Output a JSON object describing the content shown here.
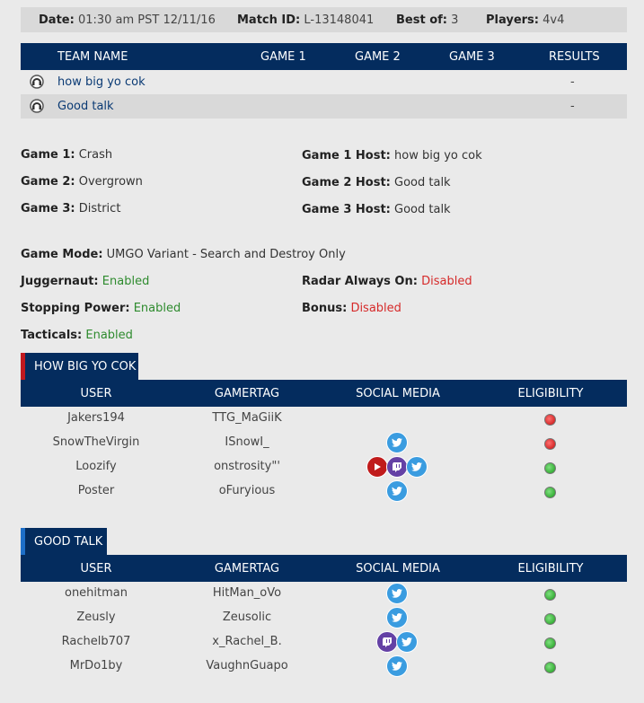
{
  "match": {
    "date_label": "Date:",
    "date_value": "01:30 am PST 12/11/16",
    "id_label": "Match ID:",
    "id_value": "L-13148041",
    "best_label": "Best of:",
    "best_value": "3",
    "players_label": "Players:",
    "players_value": "4v4"
  },
  "teams_table": {
    "headers": [
      "TEAM NAME",
      "GAME 1",
      "GAME 2",
      "GAME 3",
      "RESULTS"
    ],
    "rows": [
      {
        "name": "how big yo cok",
        "result": "-"
      },
      {
        "name": "Good talk",
        "result": "-"
      }
    ]
  },
  "games": {
    "g1_label": "Game 1:",
    "g1_value": "Crash",
    "g2_label": "Game 2:",
    "g2_value": "Overgrown",
    "g3_label": "Game 3:",
    "g3_value": "District",
    "h1_label": "Game 1 Host:",
    "h1_value": "how big yo cok",
    "h2_label": "Game 2 Host:",
    "h2_value": "Good talk",
    "h3_label": "Game 3 Host:",
    "h3_value": "Good talk"
  },
  "settings": {
    "mode_label": "Game Mode:",
    "mode_value": "UMGO Variant - Search and Destroy Only",
    "jug_label": "Juggernaut:",
    "jug_value": "Enabled",
    "sp_label": "Stopping Power:",
    "sp_value": "Enabled",
    "tac_label": "Tacticals:",
    "tac_value": "Enabled",
    "radar_label": "Radar Always On:",
    "radar_value": "Disabled",
    "bonus_label": "Bonus:",
    "bonus_value": "Disabled"
  },
  "roster_headers": [
    "USER",
    "GAMERTAG",
    "SOCIAL MEDIA",
    "ELIGIBILITY"
  ],
  "team1": {
    "title": "HOW BIG YO COK",
    "accent": "#c0191f",
    "players": [
      {
        "user": "Jakers194",
        "gamertag": "TTG_MaGiiK",
        "social": [],
        "eligible": false
      },
      {
        "user": "SnowTheVirgin",
        "gamertag": "ISnowI_",
        "social": [
          "twitter"
        ],
        "eligible": false
      },
      {
        "user": "Loozify",
        "gamertag": "onstrosity\"'",
        "social": [
          "youtube",
          "twitch",
          "twitter"
        ],
        "eligible": true
      },
      {
        "user": "Poster",
        "gamertag": "oFuryious",
        "social": [
          "twitter"
        ],
        "eligible": true
      }
    ]
  },
  "team2": {
    "title": "GOOD TALK",
    "accent": "#1e6fc8",
    "players": [
      {
        "user": "onehitman",
        "gamertag": "HitMan_oVo",
        "social": [
          "twitter"
        ],
        "eligible": true
      },
      {
        "user": "Zeusly",
        "gamertag": "Zeusolic",
        "social": [
          "twitter"
        ],
        "eligible": true
      },
      {
        "user": "Rachelb707",
        "gamertag": "x_Rachel_B.",
        "social": [
          "twitch",
          "twitter"
        ],
        "eligible": true
      },
      {
        "user": "MrDo1by",
        "gamertag": "VaughnGuapo",
        "social": [
          "twitter"
        ],
        "eligible": true
      }
    ]
  }
}
